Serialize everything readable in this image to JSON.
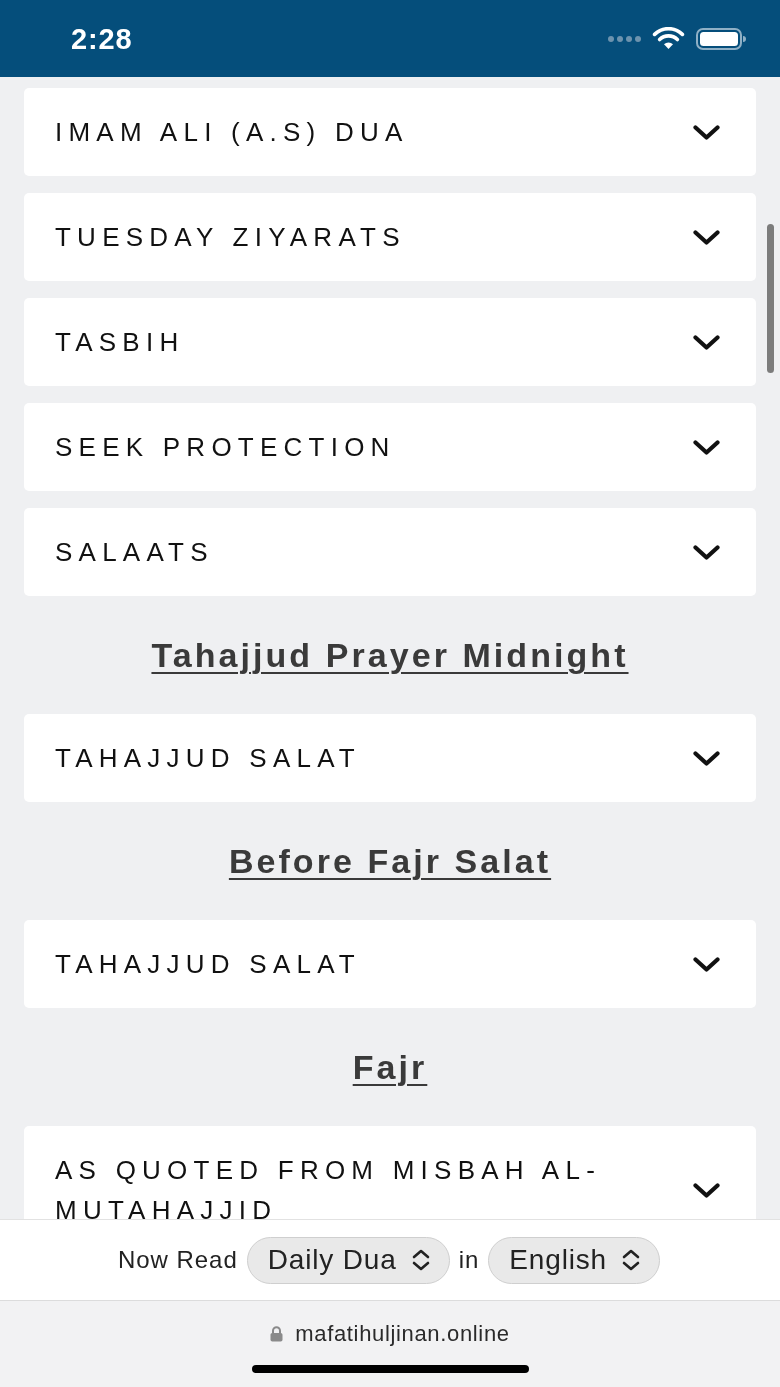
{
  "status_bar": {
    "time": "2:28"
  },
  "items": [
    {
      "kind": "accordion",
      "label": "IMAM ALI (A.S) DUA",
      "expanded": false
    },
    {
      "kind": "accordion",
      "label": "TUESDAY ZIYARATS",
      "expanded": false
    },
    {
      "kind": "accordion",
      "label": "TASBIH",
      "expanded": false
    },
    {
      "kind": "accordion",
      "label": "SEEK PROTECTION",
      "expanded": false
    },
    {
      "kind": "accordion",
      "label": "SALAATS",
      "expanded": false
    },
    {
      "kind": "heading",
      "label": "Tahajjud Prayer Midnight"
    },
    {
      "kind": "accordion",
      "label": "TAHAJJUD SALAT",
      "expanded": false
    },
    {
      "kind": "heading",
      "label": "Before Fajr Salat"
    },
    {
      "kind": "accordion",
      "label": "TAHAJJUD SALAT",
      "expanded": false
    },
    {
      "kind": "heading",
      "label": "Fajr"
    },
    {
      "kind": "accordion",
      "label": "AS QUOTED FROM MISBAH AL-MUTAHAJJID",
      "expanded": false
    }
  ],
  "reader_bar": {
    "label": "Now Read",
    "book_select": {
      "value": "Daily Dua"
    },
    "joiner": "in",
    "language_select": {
      "value": "English"
    }
  },
  "browser_bar": {
    "url": "mafatihuljinan.online"
  }
}
